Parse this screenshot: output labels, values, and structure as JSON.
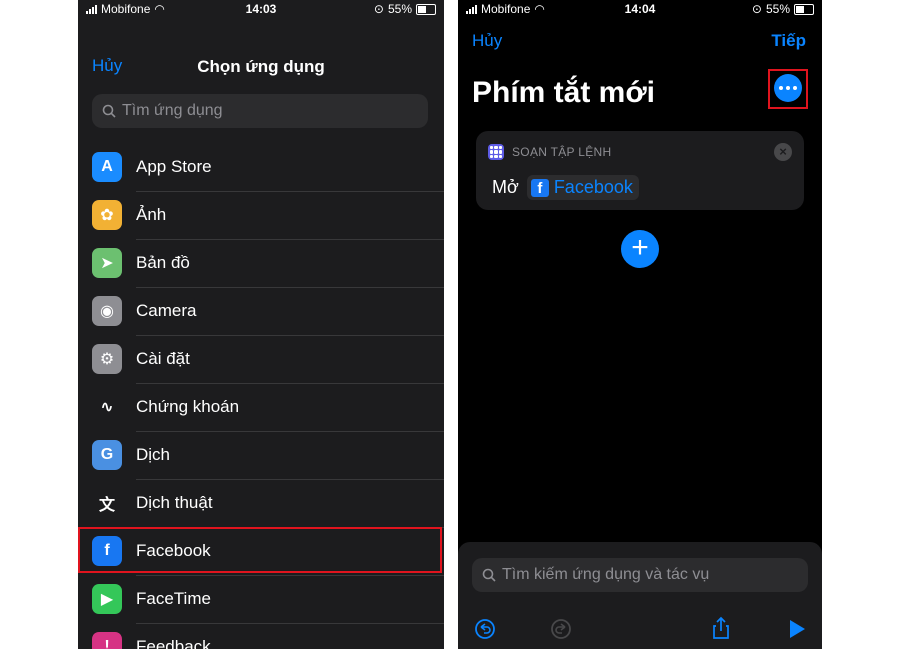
{
  "left_screen": {
    "status": {
      "carrier": "Mobifone",
      "time": "14:03",
      "battery": "55%"
    },
    "nav": {
      "cancel": "Hủy",
      "title": "Chọn ứng dụng"
    },
    "search": {
      "placeholder": "Tìm ứng dụng"
    },
    "apps": [
      {
        "label": "App Store",
        "icon": "app-store-icon",
        "color": "#1a8cff",
        "glyph": "A"
      },
      {
        "label": "Ảnh",
        "icon": "photos-icon",
        "color": "#f2b134",
        "glyph": "✿"
      },
      {
        "label": "Bản đồ",
        "icon": "maps-icon",
        "color": "#6cc070",
        "glyph": "➤"
      },
      {
        "label": "Camera",
        "icon": "camera-icon",
        "color": "#8e8e93",
        "glyph": "◉"
      },
      {
        "label": "Cài đặt",
        "icon": "settings-icon",
        "color": "#8e8e93",
        "glyph": "⚙"
      },
      {
        "label": "Chứng khoán",
        "icon": "stocks-icon",
        "color": "#1c1c1e",
        "glyph": "∿"
      },
      {
        "label": "Dịch",
        "icon": "translate-icon",
        "color": "#4a90e2",
        "glyph": "G"
      },
      {
        "label": "Dịch thuật",
        "icon": "translation-icon",
        "color": "#1c1c1e",
        "glyph": "文"
      },
      {
        "label": "Facebook",
        "icon": "facebook-icon",
        "color": "#1877f2",
        "glyph": "f"
      },
      {
        "label": "FaceTime",
        "icon": "facetime-icon",
        "color": "#34c759",
        "glyph": "▶"
      },
      {
        "label": "Feedback",
        "icon": "feedback-icon",
        "color": "#d63384",
        "glyph": "!"
      }
    ]
  },
  "right_screen": {
    "status": {
      "carrier": "Mobifone",
      "time": "14:04",
      "battery": "55%"
    },
    "nav": {
      "cancel": "Hủy",
      "next": "Tiếp"
    },
    "title": "Phím tắt mới",
    "action_card": {
      "header": "SOẠN TẬP LỆNH",
      "verb": "Mở",
      "app": "Facebook"
    },
    "search": {
      "placeholder": "Tìm kiếm ứng dụng và tác vụ"
    }
  },
  "colors": {
    "accent": "#0a84ff",
    "highlight": "#e0141e"
  }
}
